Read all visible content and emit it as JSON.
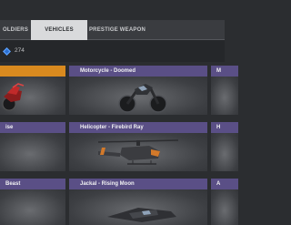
{
  "tabs": [
    {
      "label": "SOLDIERS",
      "visible": "OLDIERS",
      "active": false
    },
    {
      "label": "VEHICLES",
      "active": true
    },
    {
      "label": "PRESTIGE WEAPON",
      "active": false
    }
  ],
  "count": {
    "icon": "diamond-icon",
    "value": "274"
  },
  "cards": [
    {
      "title": "",
      "header_color": "#d98a1f",
      "vehicle": "motorcycle-red"
    },
    {
      "title": "Motorcycle - Doomed",
      "header_color": "#5a4f86",
      "vehicle": "motorcycle-dark"
    },
    {
      "title": "M",
      "header_color": "#5a4f86",
      "vehicle": "partial"
    },
    {
      "title": "ise",
      "header_color": "#5a4f86",
      "vehicle": "partial"
    },
    {
      "title": "Helicopter - Firebird Ray",
      "header_color": "#5a4f86",
      "vehicle": "helicopter"
    },
    {
      "title": "H",
      "header_color": "#5a4f86",
      "vehicle": "partial"
    },
    {
      "title": "Beast",
      "header_color": "#5a4f86",
      "vehicle": "partial"
    },
    {
      "title": "Jackal - Rising Moon",
      "header_color": "#5a4f86",
      "vehicle": "jet"
    },
    {
      "title": "A",
      "header_color": "#5a4f86",
      "vehicle": "partial"
    }
  ],
  "colors": {
    "accent": "#d98a1f",
    "header": "#5a4f86",
    "background": "#2b2d30"
  }
}
